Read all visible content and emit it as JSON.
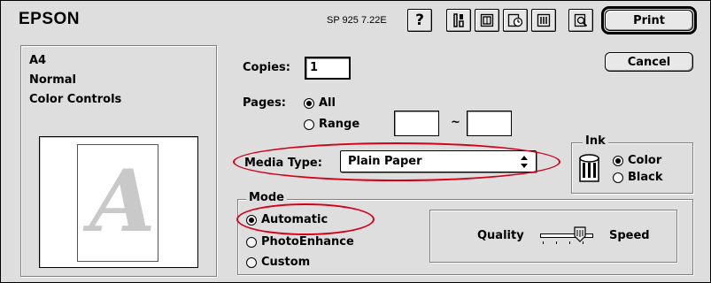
{
  "header": {
    "brand": "EPSON",
    "version": "SP 925 7.22E",
    "help_glyph": "?",
    "toolbar_icons": [
      "utility-icon",
      "layout-icon",
      "background-print-icon",
      "printer-settings-icon",
      "preview-icon"
    ]
  },
  "buttons": {
    "print": "Print",
    "cancel": "Cancel"
  },
  "summary": {
    "paper_size": "A4",
    "orientation": "Normal",
    "color_mode": "Color Controls",
    "preview_letter": "A"
  },
  "copies": {
    "label": "Copies:",
    "value": "1"
  },
  "pages": {
    "label": "Pages:",
    "all_label": "All",
    "range_label": "Range",
    "range_separator": "~",
    "selected": "All",
    "from": "",
    "to": ""
  },
  "media_type": {
    "label": "Media Type:",
    "value": "Plain Paper"
  },
  "ink": {
    "label": "Ink",
    "options": [
      "Color",
      "Black"
    ],
    "selected": "Color"
  },
  "mode": {
    "label": "Mode",
    "options": [
      "Automatic",
      "PhotoEnhance",
      "Custom"
    ],
    "selected": "Automatic"
  },
  "quality_slider": {
    "left_label": "Quality",
    "right_label": "Speed",
    "position": 0.75
  },
  "annotation_color": "#d4001a"
}
